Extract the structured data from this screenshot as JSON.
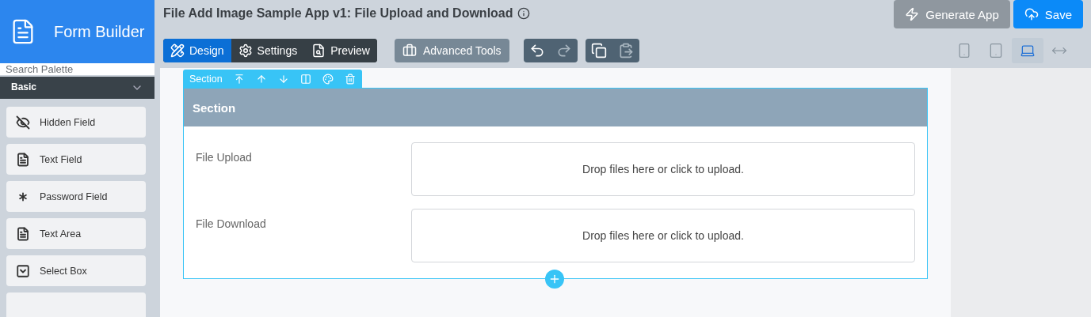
{
  "brand": {
    "title": "Form Builder"
  },
  "app_title": "File Add Image Sample App v1: File Upload and Download",
  "actions": [
    {
      "label": "Generate App",
      "kind": "generate"
    },
    {
      "label": "Save",
      "kind": "save"
    }
  ],
  "tabs": [
    {
      "label": "Design",
      "kind": "design",
      "selected": true
    },
    {
      "label": "Settings",
      "kind": "settings",
      "selected": false
    },
    {
      "label": "Preview",
      "kind": "preview",
      "selected": false
    }
  ],
  "advanced_tools": "Advanced Tools",
  "history": [
    {
      "kind": "undo",
      "disabled": false
    },
    {
      "kind": "redo",
      "disabled": true
    }
  ],
  "clipboard": [
    {
      "kind": "copy",
      "disabled": false
    },
    {
      "kind": "paste",
      "disabled": true
    }
  ],
  "devices": [
    {
      "kind": "phone",
      "selected": false
    },
    {
      "kind": "tablet",
      "selected": false
    },
    {
      "kind": "laptop",
      "selected": true
    },
    {
      "kind": "full",
      "selected": false
    }
  ],
  "palette": {
    "placeholder": "Search Palette",
    "category": "Basic",
    "expanded": true,
    "items": [
      {
        "label": "Hidden Field",
        "kind": "hidden"
      },
      {
        "label": "Text Field",
        "kind": "text"
      },
      {
        "label": "Password Field",
        "kind": "password"
      },
      {
        "label": "Text Area",
        "kind": "textarea"
      },
      {
        "label": "Select Box",
        "kind": "select"
      }
    ]
  },
  "section": {
    "toolbar_label": "Section",
    "title": "Section",
    "fields": [
      {
        "label": "File Upload",
        "dropzone": "Drop files here or click to upload."
      },
      {
        "label": "File Download",
        "dropzone": "Drop files here or click to upload."
      }
    ]
  }
}
